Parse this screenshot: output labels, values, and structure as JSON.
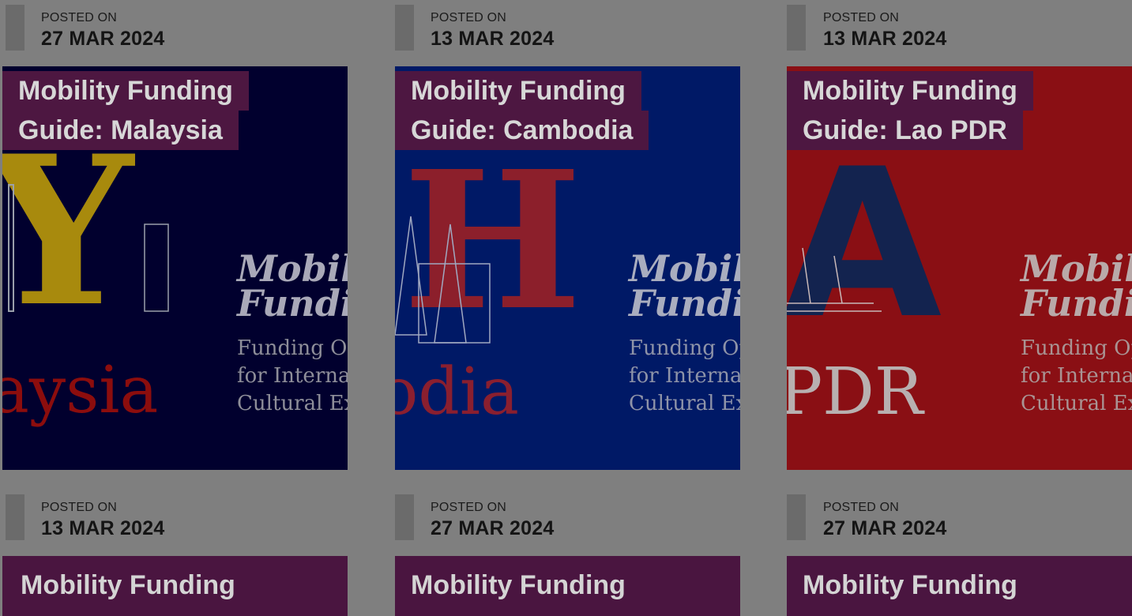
{
  "colors": {
    "background": "#7f7f7f",
    "title_bg": "#4d1741",
    "malaysia_bg": "#01002e",
    "cambodia_bg": "#001966",
    "lao_bg": "#8a0f14"
  },
  "cards_top": [
    {
      "posted_label": "POSTED ON",
      "date": "27 MAR 2024",
      "title_line1": "Mobility Funding",
      "title_line2": "Guide: Malaysia",
      "art": {
        "big_letter": "Y",
        "word": "aysia",
        "heading1": "Mobili",
        "heading2": "Fundi",
        "sub1": "Funding Op",
        "sub2": "for Internat",
        "sub3": "Cultural Ex"
      }
    },
    {
      "posted_label": "POSTED ON",
      "date": "13 MAR 2024",
      "title_line1": "Mobility Funding",
      "title_line2": "Guide: Cambodia",
      "art": {
        "big_letter": "H",
        "word": "odia",
        "heading1": "Mobili",
        "heading2": "Fundi",
        "sub1": "Funding Op",
        "sub2": "for Internat",
        "sub3": "Cultural Ex"
      }
    },
    {
      "posted_label": "POSTED ON",
      "date": "13 MAR 2024",
      "title_line1": "Mobility Funding",
      "title_line2": "Guide: Lao PDR",
      "art": {
        "big_letter": "A",
        "word": "PDR",
        "heading1": "Mobili",
        "heading2": "Fundi",
        "sub1": "Funding Op",
        "sub2": "for Internat",
        "sub3": "Cultural Ex"
      }
    }
  ],
  "cards_bottom": [
    {
      "posted_label": "POSTED ON",
      "date": "13 MAR 2024",
      "title_line1": "Mobility Funding"
    },
    {
      "posted_label": "POSTED ON",
      "date": "27 MAR 2024",
      "title_line1": "Mobility Funding"
    },
    {
      "posted_label": "POSTED ON",
      "date": "27 MAR 2024",
      "title_line1": "Mobility Funding"
    }
  ]
}
